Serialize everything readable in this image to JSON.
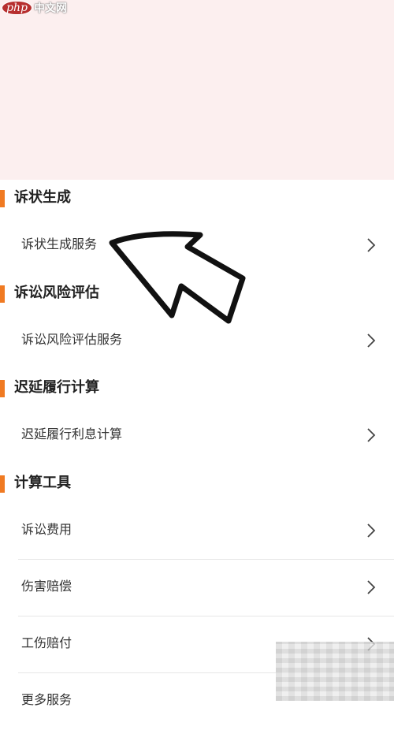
{
  "watermark": {
    "logo_text": "php",
    "site_name": "中文网"
  },
  "sections": [
    {
      "title": "诉状生成",
      "items": [
        "诉状生成服务"
      ]
    },
    {
      "title": "诉讼风险评估",
      "items": [
        "诉讼风险评估服务"
      ]
    },
    {
      "title": "迟延履行计算",
      "items": [
        "迟延履行利息计算"
      ]
    },
    {
      "title": "计算工具",
      "items": [
        "诉讼费用",
        "伤害赔偿",
        "工伤赔付",
        "更多服务"
      ]
    }
  ],
  "colors": {
    "banner": "#fcefef",
    "accent": "#f07a22",
    "text": "#333333"
  },
  "icons": {
    "chevron": "chevron-right-icon",
    "annotation": "pointer-arrow-icon"
  }
}
